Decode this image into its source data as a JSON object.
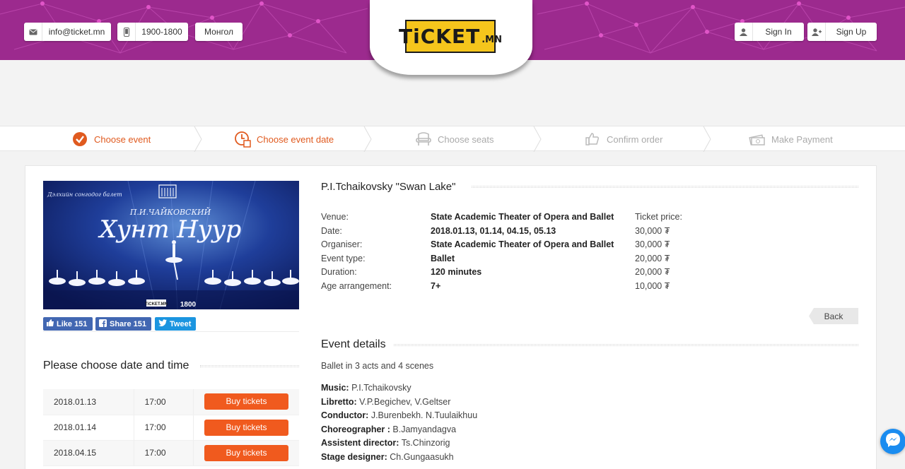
{
  "header": {
    "email": "info@ticket.mn",
    "phone": "1900-1800",
    "language": "Монгол",
    "sign_in": "Sign In",
    "sign_up": "Sign Up",
    "logo_text": "TiCKET",
    "logo_suffix": ".MN"
  },
  "steps": [
    {
      "label": "Choose event",
      "state": "done"
    },
    {
      "label": "Choose event date",
      "state": "current"
    },
    {
      "label": "Choose seats",
      "state": "pending"
    },
    {
      "label": "Confirm order",
      "state": "pending"
    },
    {
      "label": "Make Payment",
      "state": "pending"
    }
  ],
  "poster": {
    "title_line": "П.И.ЧАЙКОВСКИЙ",
    "title_main": "Хунт Нуур",
    "top_text": "Дэлхийн сонгодог балет",
    "badge": "TiCKET.MN",
    "phone": "1800"
  },
  "social": {
    "like": "Like 151",
    "share": "Share 151",
    "tweet": "Tweet"
  },
  "dates_section": {
    "title": "Please choose date and time",
    "rows": [
      {
        "date": "2018.01.13",
        "time": "17:00",
        "button": "Buy tickets"
      },
      {
        "date": "2018.01.14",
        "time": "17:00",
        "button": "Buy tickets"
      },
      {
        "date": "2018.04.15",
        "time": "17:00",
        "button": "Buy tickets"
      }
    ]
  },
  "event": {
    "title": "P.I.Tchaikovsky \"Swan Lake\"",
    "labels": [
      "Venue:",
      "Date:",
      "Organiser:",
      "Event type:",
      "Duration:",
      "Age arrangement:"
    ],
    "values": [
      "State Academic Theater of Opera and Ballet",
      "2018.01.13, 01.14, 04.15, 05.13",
      "State Academic Theater of Opera and Ballet",
      "Ballet",
      "120 minutes",
      "7+"
    ],
    "price_label": "Ticket price:",
    "prices": [
      "30,000 ₮",
      "30,000 ₮",
      "20,000 ₮",
      "20,000 ₮",
      "10,000 ₮"
    ],
    "back": "Back"
  },
  "details": {
    "title": "Event details",
    "description": "Ballet in 3 acts and 4 scenes",
    "credits": [
      {
        "role": "Music:",
        "name": " P.I.Tchaikovsky"
      },
      {
        "role": "Libretto:",
        "name": " V.P.Begichev, V.Geltser"
      },
      {
        "role": "Conductor:",
        "name": " J.Burenbekh. N.Tuulaikhuu"
      },
      {
        "role": "Choreographer :",
        "name": " B.Jamyandagva"
      },
      {
        "role": "Assistent director:",
        "name": " Ts.Chinzorig"
      },
      {
        "role": "Stage designer:",
        "name": " Ch.Gungaasukh"
      }
    ]
  },
  "colors": {
    "header_bg": "#9c2a8e",
    "accent": "#f05a1e",
    "logo_yellow": "#f5c51c"
  }
}
